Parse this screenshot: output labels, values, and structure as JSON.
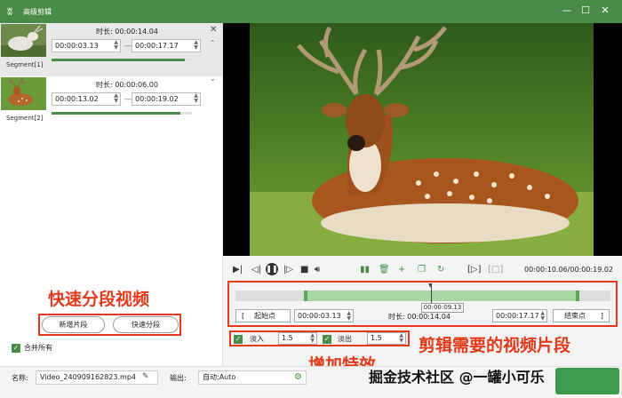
{
  "window": {
    "title": "高级剪辑",
    "controls": [
      "—",
      "☐",
      "✕"
    ]
  },
  "segments": [
    {
      "label": "Segment[1]",
      "duration_label": "时长:",
      "duration": "00:00:14.04",
      "start": "00:00:03.13",
      "end": "00:00:17.17",
      "progress": 0.95
    },
    {
      "label": "Segment[2]",
      "duration_label": "时长:",
      "duration": "00:00:06.00",
      "start": "00:00:13.02",
      "end": "00:00:19.02",
      "progress": 0.92
    }
  ],
  "left_buttons": {
    "add_segment": "新增片段",
    "quick_split": "快速分段"
  },
  "merge_all": {
    "label": "合并所有",
    "checked": true
  },
  "annotations": {
    "quick_split": "快速分段视频",
    "clip_needed": "剪辑需要的视频片段",
    "add_effects": "增加特效"
  },
  "player": {
    "timecode": "00:00:10.06/00:00:19.02",
    "icons": [
      "prev-frame-icon",
      "rewind-icon",
      "pause-icon",
      "forward-icon",
      "stop-icon",
      "volume-icon",
      "split-icon",
      "delete-icon",
      "add-icon",
      "copy-icon",
      "reset-icon",
      "mark-in-icon",
      "mark-out-icon"
    ]
  },
  "timeline": {
    "tooltip": "00:00:09.13",
    "start_btn_bracket": "[",
    "start_btn": "起始点",
    "start_value": "00:00:03.13",
    "duration_label": "时长:",
    "duration": "00:00:14.04",
    "end_value": "00:00:17.17",
    "end_btn": "结束点",
    "end_btn_bracket": "]"
  },
  "fades": {
    "fade_in_label": "淡入",
    "fade_in_value": "1.5",
    "fade_out_label": "淡出",
    "fade_out_value": "1.5"
  },
  "footer": {
    "name_label": "名称:",
    "file_name": "Video_240909162823.mp4",
    "output_label": "输出:",
    "output_value": "自动;Auto",
    "watermark": "掘金技术社区 @一罐小可乐"
  },
  "colors": {
    "accent": "#4a8c47",
    "annotation": "#e23a1a"
  }
}
